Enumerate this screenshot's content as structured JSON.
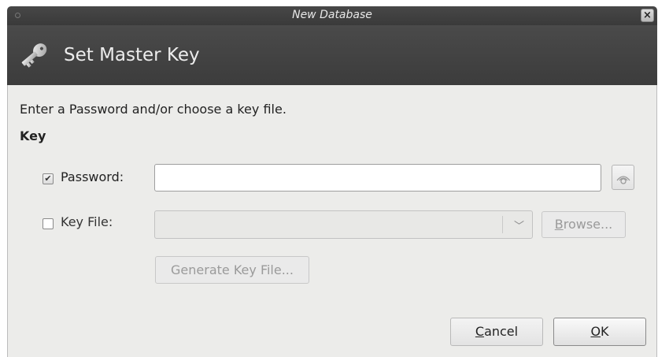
{
  "window": {
    "title": "New Database",
    "close_glyph": "×"
  },
  "header": {
    "title": "Set Master Key",
    "icon": "key-icon"
  },
  "content": {
    "intro": "Enter a Password and/or choose a key file.",
    "section_label": "Key",
    "password": {
      "checkbox_checked": true,
      "label": "Password:",
      "value": "",
      "toggle_icon": "eye-icon"
    },
    "key_file": {
      "checkbox_checked": false,
      "label": "Key File:",
      "value": "",
      "browse_prefix": "B",
      "browse_rest": "rowse..."
    },
    "generate_button": "Generate Key File..."
  },
  "buttons": {
    "cancel_prefix": "C",
    "cancel_rest": "ancel",
    "ok_prefix": "O",
    "ok_rest": "K"
  }
}
